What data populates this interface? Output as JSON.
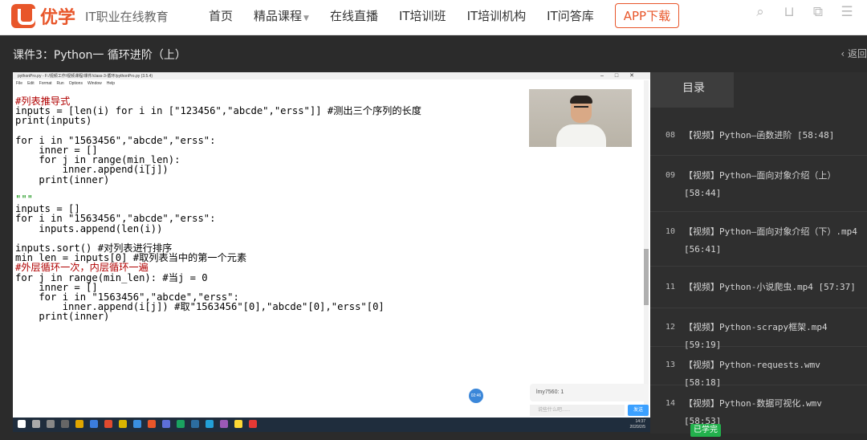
{
  "site": {
    "logo_text": "优学",
    "slogan": "IT职业在线教育"
  },
  "nav": {
    "items": [
      "首页",
      "精品课程",
      "在线直播",
      "IT培训班",
      "IT培训机构",
      "IT问答库"
    ],
    "app_label": "APP下载"
  },
  "lesson": {
    "title": "课件3：Python一 循环进阶（上）",
    "back_label": "‹ 返回"
  },
  "editor": {
    "window_title": "pythonPro.py - F:/视频工作/视频课程/课件/class-3-循环/pythonPro.py (3.5.4)",
    "menu": [
      "File",
      "Edit",
      "Format",
      "Run",
      "Options",
      "Window",
      "Help"
    ]
  },
  "chat": {
    "message": "lmy7560: 1",
    "placeholder": "说些什么吧......",
    "send": "发送"
  },
  "float_btn": "02:46",
  "taskbar": {
    "time": "14:37",
    "date": "2020/2/5"
  },
  "sidebar": {
    "tab_label": "目录",
    "items": [
      {
        "num": "08",
        "line1": "【视频】Python—函数进阶 [58:48]",
        "line2": ""
      },
      {
        "num": "09",
        "line1": "【视频】Python—面向对象介绍（上）",
        "line2": "[58:44]"
      },
      {
        "num": "10",
        "line1": "【视频】Python—面向对象介绍（下）.mp4",
        "line2": "[56:41]"
      },
      {
        "num": "11",
        "line1": "【视频】Python-小说爬虫.mp4 [57:37]",
        "line2": ""
      },
      {
        "num": "12",
        "line1": "【视频】Python-scrapy框架.mp4 [59:19]",
        "line2": ""
      },
      {
        "num": "13",
        "line1": "【视频】Python-requests.wmv [58:18]",
        "line2": ""
      },
      {
        "num": "14",
        "line1": "【视频】Python-数据可视化.wmv [58:53]",
        "line2": ""
      }
    ],
    "learned_badge": "已学完"
  },
  "colors": {
    "brand": "#e8562a",
    "learned": "#22b14c"
  }
}
